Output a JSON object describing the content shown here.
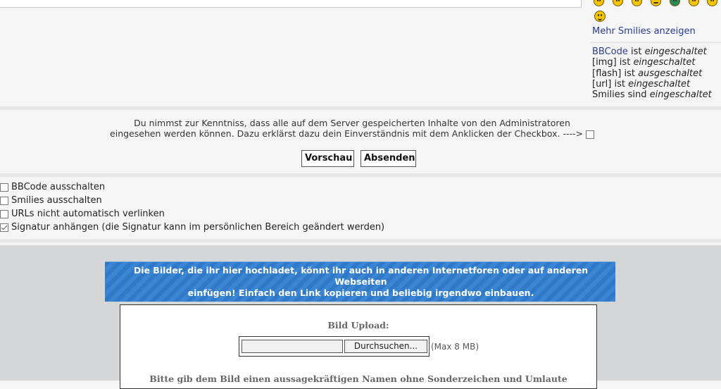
{
  "sidebar": {
    "smilies": [
      "exclaim",
      "idea",
      "question",
      "neutral",
      "shock",
      "eek",
      "cool",
      "smile"
    ],
    "more_smilies_label": "Mehr Smilies anzeigen",
    "status": {
      "bbcode_link": "BBCode",
      "bbcode_text": "ist",
      "bbcode_state": "eingeschaltet",
      "img_text": "[img] ist",
      "img_state": "eingeschaltet",
      "flash_text": "[flash] ist",
      "flash_state": "ausgeschaltet",
      "url_text": "[url] ist",
      "url_state": "eingeschaltet",
      "smilies_text": "Smilies sind",
      "smilies_state": "eingeschaltet"
    }
  },
  "terms": {
    "line1": "Du nimmst zur Kenntniss, dass alle auf dem Server gespeicherten Inhalte von den Administratoren",
    "line2": "eingesehen werden können. Dazu erklärst dazu dein Einverständnis mit dem Anklicken der Checkbox. ---->",
    "checked": false
  },
  "buttons": {
    "preview": "Vorschau",
    "submit": "Absenden"
  },
  "options": [
    {
      "label": "BBCode ausschalten",
      "checked": false
    },
    {
      "label": "Smilies ausschalten",
      "checked": false
    },
    {
      "label": "URLs nicht automatisch verlinken",
      "checked": false
    },
    {
      "label": "Signatur anhängen (die Signatur kann im persönlichen Bereich geändert werden)",
      "checked": true
    }
  ],
  "upload": {
    "banner_line1": "Die Bilder, die ihr hier hochladet, könnt ihr auch in anderen Internetforen oder auf anderen Webseiten",
    "banner_line2": "einfügen! Einfach den Link kopieren und beliebig irgendwo einbauen.",
    "label": "Bild Upload:",
    "browse_label": "Durchsuchen...",
    "max_size": "(Max 8 MB)",
    "hint": "Bitte gib dem Bild einen aussagekräftigen Namen ohne Sonderzeichen und Umlaute"
  },
  "colors": {
    "link": "#2a3c94",
    "banner": "#2f79c8",
    "upload_bg": "#d4d6d8"
  }
}
